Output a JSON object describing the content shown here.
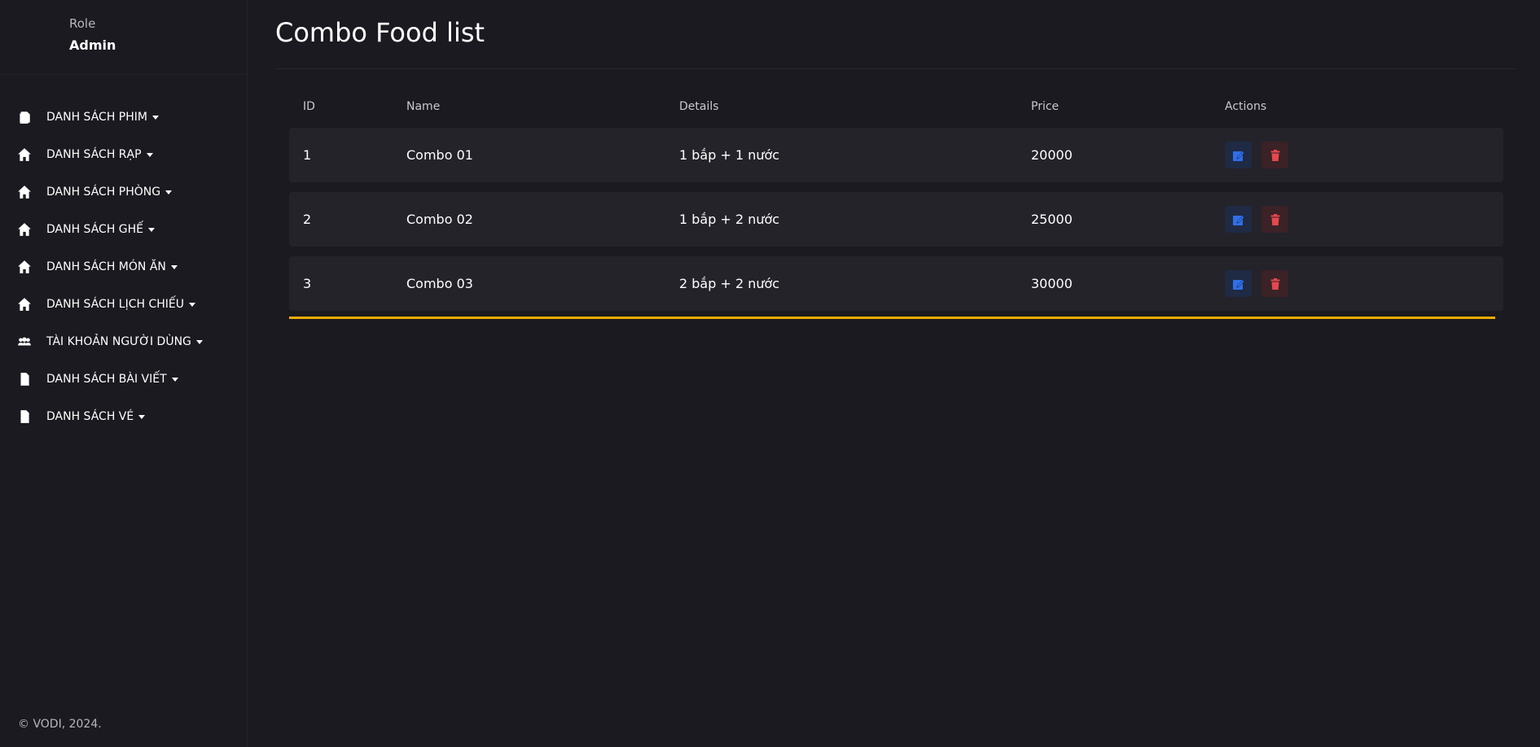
{
  "sidebar": {
    "role_label": "Role",
    "role_value": "Admin",
    "items": [
      {
        "label": "DANH SÁCH PHIM",
        "icon": "copy-icon"
      },
      {
        "label": "DANH SÁCH RẠP",
        "icon": "home-icon"
      },
      {
        "label": "DANH SÁCH PHÒNG",
        "icon": "home-icon"
      },
      {
        "label": "DANH SÁCH GHẾ",
        "icon": "home-icon"
      },
      {
        "label": "DANH SÁCH MÓN ĂN",
        "icon": "home-icon"
      },
      {
        "label": "DANH SÁCH LỊCH CHIẾU",
        "icon": "home-icon"
      },
      {
        "label": "TÀI KHOẢN NGƯỜI DÙNG",
        "icon": "users-icon"
      },
      {
        "label": "DANH SÁCH BÀI VIẾT",
        "icon": "file-icon"
      },
      {
        "label": "DANH SÁCH VÉ",
        "icon": "file-icon"
      }
    ],
    "footer": "© VODI, 2024."
  },
  "main": {
    "title": "Combo Food list",
    "table": {
      "headers": {
        "id": "ID",
        "name": "Name",
        "details": "Details",
        "price": "Price",
        "actions": "Actions"
      },
      "rows": [
        {
          "id": "1",
          "name": "Combo 01",
          "details": "1 bắp + 1 nước",
          "price": "20000"
        },
        {
          "id": "2",
          "name": "Combo 02",
          "details": "1 bắp + 2 nước",
          "price": "25000"
        },
        {
          "id": "3",
          "name": "Combo 03",
          "details": "2 bắp + 2 nước",
          "price": "30000"
        }
      ]
    }
  },
  "colors": {
    "background": "#1b1a20",
    "row_background": "#24232a",
    "accent": "#f5ab00",
    "edit_icon": "#2f6fe8",
    "delete_icon": "#e5484d"
  }
}
